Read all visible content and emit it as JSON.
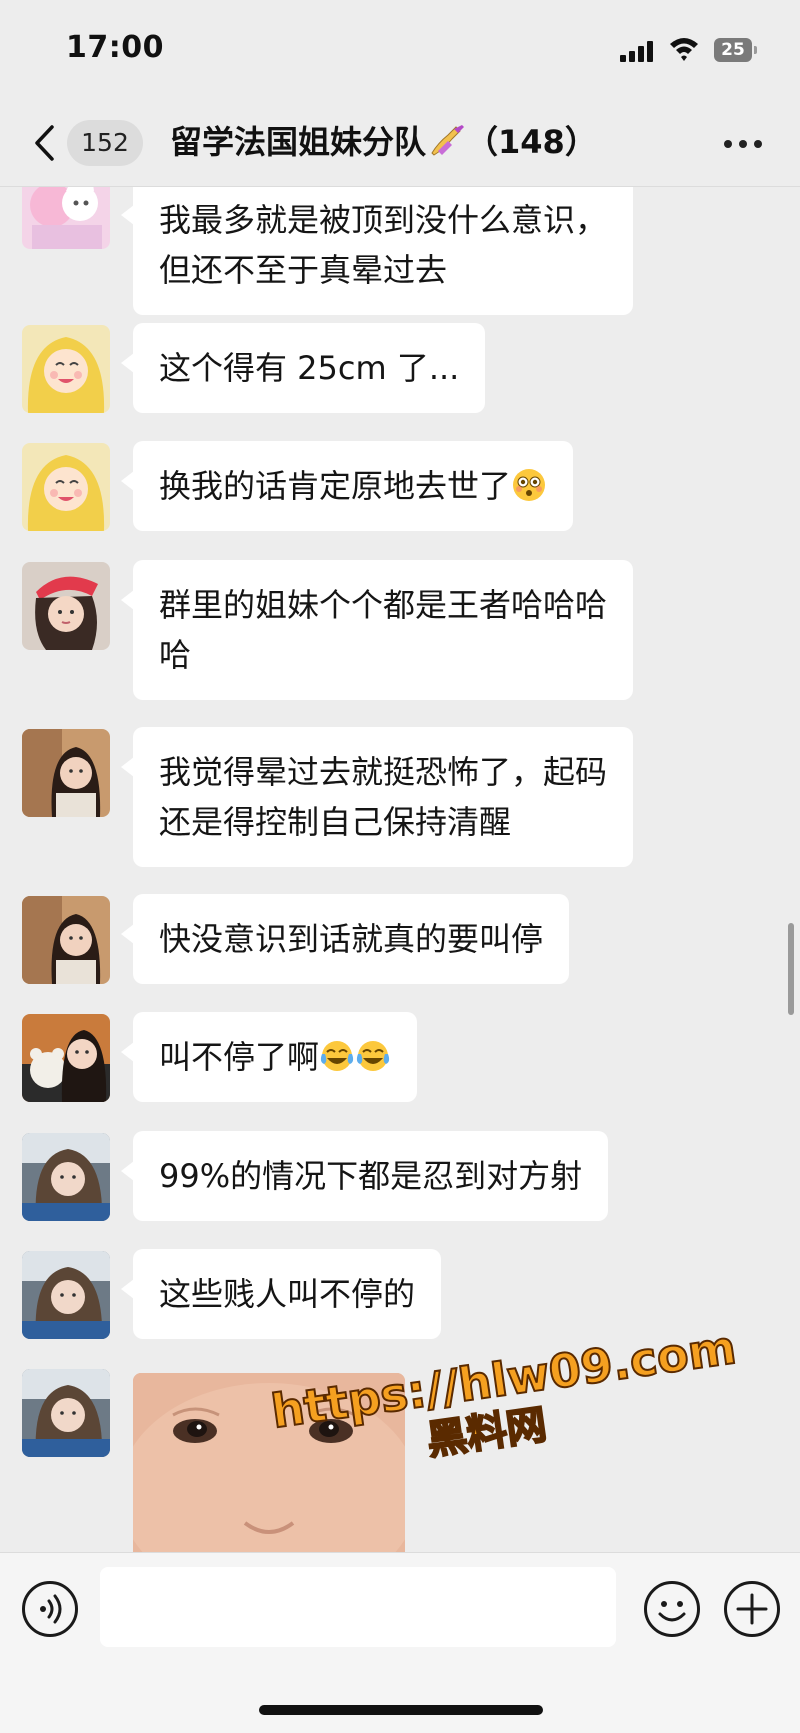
{
  "status_bar": {
    "time": "17:00",
    "battery": "25"
  },
  "nav": {
    "back_icon": "chevron-left-icon",
    "unread_count": "152",
    "chat_title": "留学法国姐妹分队",
    "title_emoji": "nail-polish-emoji",
    "member_count": "（148）",
    "more_icon": "ellipsis-icon"
  },
  "messages": [
    {
      "text": "我最多就是被顶到没什么意识，",
      "text2": "但还不至于真晕过去",
      "avatar": "pink-anime-cat-avatar"
    },
    {
      "text": "这个得有 25cm 了...",
      "avatar": "blonde-anime-girl-avatar"
    },
    {
      "text": "换我的话肯定原地去世了",
      "emoji": "flushed-face-emoji",
      "avatar": "blonde-anime-girl-avatar"
    },
    {
      "text": "群里的姐妹个个都是王者哈哈哈",
      "text2": "哈",
      "avatar": "red-beret-girl-avatar"
    },
    {
      "text": "我觉得晕过去就挺恐怖了，起码",
      "text2": "还是得控制自己保持清醒",
      "avatar": "dark-hair-girl-avatar"
    },
    {
      "text": "快没意识到话就真的要叫停",
      "avatar": "dark-hair-girl-avatar"
    },
    {
      "text": "叫不停了啊",
      "emoji": "tears-of-joy-emoji",
      "avatar": "girl-with-bear-avatar"
    },
    {
      "text": "99%的情况下都是忍到对方射",
      "avatar": "car-selfie-girl-avatar"
    },
    {
      "text": "这些贱人叫不停的",
      "avatar": "car-selfie-girl-avatar"
    },
    {
      "image": "baby-face-photo",
      "avatar": "car-selfie-girl-avatar"
    }
  ],
  "watermark": {
    "url": "https://hlw09.com",
    "name": "黑料网"
  },
  "input_bar": {
    "voice_icon": "voice-icon",
    "input_value": "",
    "emoji_icon": "smiley-icon",
    "plus_icon": "plus-icon"
  },
  "colors": {
    "background": "#ededed",
    "bubble": "#ffffff",
    "input_bar": "#f5f5f5",
    "watermark": "#f5a020"
  }
}
